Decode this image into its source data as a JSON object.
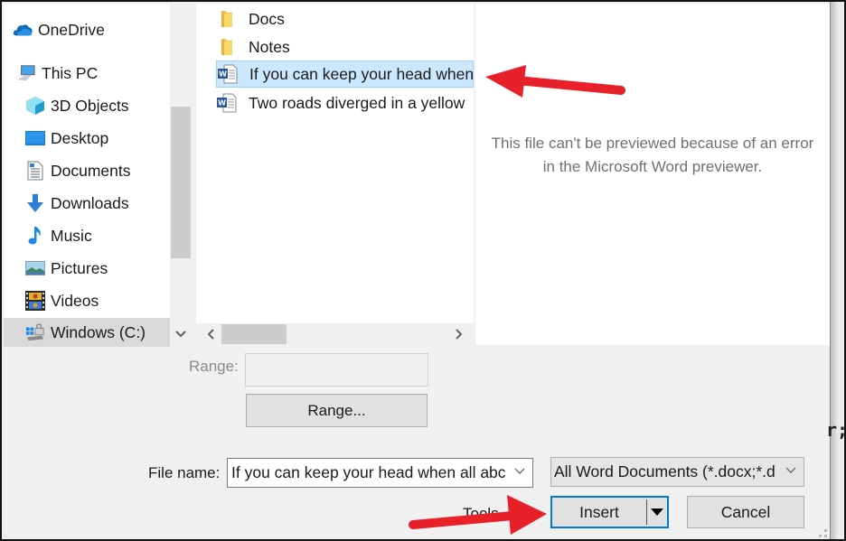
{
  "navigation": {
    "items": [
      {
        "label": "OneDrive",
        "icon": "onedrive-cloud-icon",
        "level": 0
      },
      {
        "label": "This PC",
        "icon": "computer-icon",
        "level": 0
      },
      {
        "label": "3D Objects",
        "icon": "3d-objects-icon",
        "level": 1
      },
      {
        "label": "Desktop",
        "icon": "desktop-icon",
        "level": 1
      },
      {
        "label": "Documents",
        "icon": "documents-icon",
        "level": 1
      },
      {
        "label": "Downloads",
        "icon": "download-arrow-icon",
        "level": 1
      },
      {
        "label": "Music",
        "icon": "music-note-icon",
        "level": 1
      },
      {
        "label": "Pictures",
        "icon": "pictures-icon",
        "level": 1
      },
      {
        "label": "Videos",
        "icon": "videos-icon",
        "level": 1
      },
      {
        "label": "Windows (C:)",
        "icon": "drive-icon",
        "level": 1,
        "selected": true
      }
    ]
  },
  "files": {
    "items": [
      {
        "name": "Docs",
        "type": "folder",
        "icon": "folder-icon"
      },
      {
        "name": "Notes",
        "type": "folder",
        "icon": "folder-icon"
      },
      {
        "name": "If you can keep your head when",
        "type": "word-document",
        "icon": "word-document-icon",
        "selected": true
      },
      {
        "name": "Two roads diverged in a yellow",
        "type": "word-document",
        "icon": "word-document-icon"
      }
    ]
  },
  "preview": {
    "message_line1": "This file can't be previewed because of an error",
    "message_line2": "in the Microsoft Word previewer."
  },
  "range": {
    "label": "Range:",
    "value": "",
    "button_label": "Range..."
  },
  "file_name": {
    "label": "File name:",
    "value": "If you can keep your head when all abc"
  },
  "file_type_filter": {
    "selected": "All Word Documents (*.docx;*.d"
  },
  "actions": {
    "tools_label": "Tools",
    "insert_label": "Insert",
    "cancel_label": "Cancel"
  },
  "annotations": {
    "arrow_color": "#e8202a"
  },
  "colors": {
    "selection_bg": "#cce8ff",
    "selection_border": "#99d1ff",
    "focus_border": "#0078d7"
  }
}
